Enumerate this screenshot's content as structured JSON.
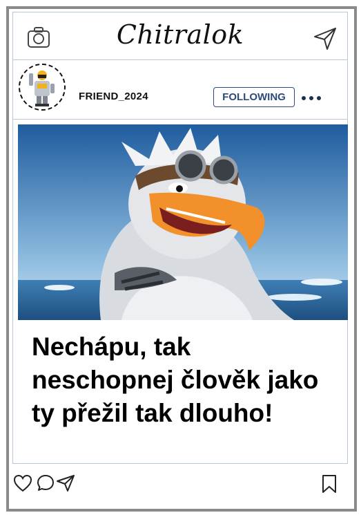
{
  "app": {
    "title": "Chitralok"
  },
  "icons": {
    "camera": "camera-icon",
    "send": "paper-plane-icon",
    "heart": "heart-icon",
    "comment": "comment-icon",
    "share": "share-icon",
    "bookmark": "bookmark-icon",
    "more": "more-dots-icon"
  },
  "post": {
    "username": "FRIEND_2024",
    "follow_label": "FOLLOWING",
    "caption": "Nechápu, tak neschopnej člověk jako ty přežil tak dlouho!"
  },
  "colors": {
    "accent": "#2c4a7a",
    "frame": "#8a8a8a",
    "divider": "#b9c7d8"
  }
}
